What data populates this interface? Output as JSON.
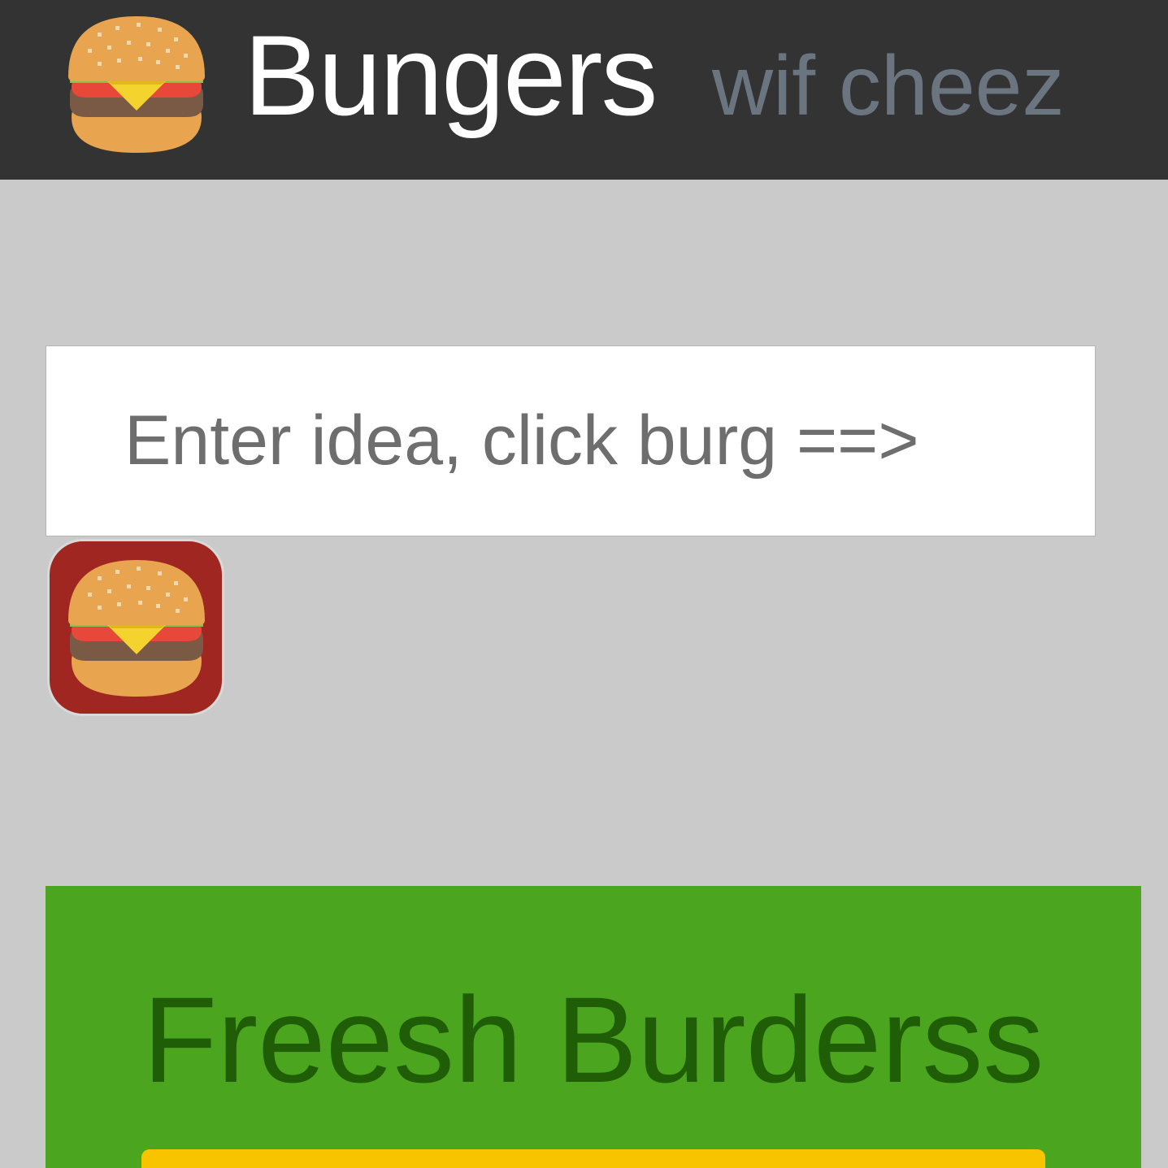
{
  "header": {
    "title": "Bungers",
    "subtitle": "wif cheez",
    "logo_icon": "hamburger-icon"
  },
  "idea_form": {
    "placeholder": "Enter idea, click burg ==>",
    "value": "",
    "submit_icon": "hamburger-icon"
  },
  "fresh_section": {
    "title": "Freesh Burderss"
  },
  "colors": {
    "header_bg": "#333333",
    "page_bg": "#cacaca",
    "subtitle": "#6b7580",
    "burg_button_bg": "#a02721",
    "fresh_panel_bg": "#4ba51e",
    "fresh_title": "#1f5e07",
    "fresh_bar": "#f8c400"
  }
}
